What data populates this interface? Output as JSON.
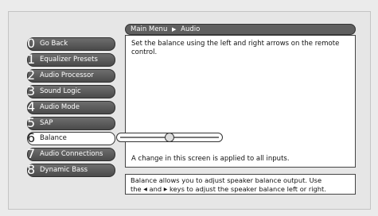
{
  "header": {
    "breadcrumb_root": "Main Menu",
    "breadcrumb_sep": "▶",
    "breadcrumb_current": "Audio"
  },
  "description": "Set the balance using the left and right arrows on the remote control.",
  "note": "A change in this screen is applied to all inputs.",
  "help": {
    "line1": "Balance allows you to adjust speaker balance output. Use",
    "line2_pre": "the",
    "arrow_left": "◀",
    "line2_mid": "and",
    "arrow_right": "▶",
    "line2_post": "keys to adjust the speaker balance left or right."
  },
  "menu": [
    {
      "num": "0",
      "label": "Go Back"
    },
    {
      "num": "1",
      "label": "Equalizer Presets"
    },
    {
      "num": "2",
      "label": "Audio Processor"
    },
    {
      "num": "3",
      "label": "Sound Logic"
    },
    {
      "num": "4",
      "label": "Audio Mode"
    },
    {
      "num": "5",
      "label": "SAP"
    },
    {
      "num": "6",
      "label": "Balance"
    },
    {
      "num": "7",
      "label": "Audio Connections"
    },
    {
      "num": "8",
      "label": "Dynamic Bass"
    }
  ],
  "balance": {
    "value_fraction": 0.5
  }
}
